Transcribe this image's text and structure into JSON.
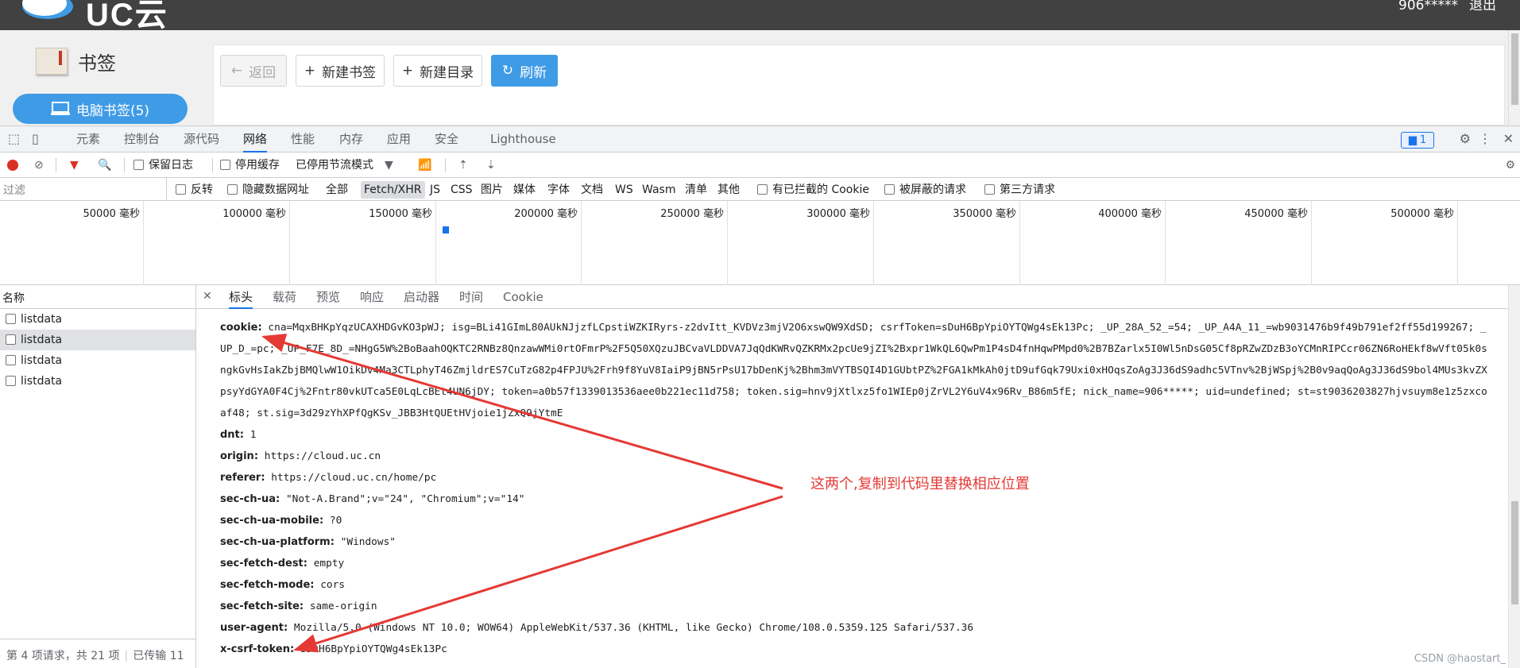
{
  "app": {
    "logo_text": "UC云",
    "user": "906*****",
    "logout": "退出",
    "sidebar_title": "书签",
    "pc_bookmarks": "电脑书签(5)",
    "toolbar": {
      "back": "返回",
      "new_bookmark": "新建书签",
      "new_folder": "新建目录",
      "refresh": "刷新"
    }
  },
  "devtools": {
    "tabs": [
      "元素",
      "控制台",
      "源代码",
      "网络",
      "性能",
      "内存",
      "应用",
      "安全",
      "Lighthouse"
    ],
    "active_tab": "网络",
    "issue_count": "1",
    "toolbar": {
      "preserve_log": "保留日志",
      "disable_cache": "停用缓存",
      "throttling": "已停用节流模式"
    },
    "filter": {
      "placeholder": "过滤",
      "invert": "反转",
      "hide_data_urls": "隐藏数据网址",
      "types": [
        "全部",
        "Fetch/XHR",
        "JS",
        "CSS",
        "图片",
        "媒体",
        "字体",
        "文档",
        "WS",
        "Wasm",
        "清单",
        "其他"
      ],
      "active_type": "Fetch/XHR",
      "blocked_cookies": "有已拦截的 Cookie",
      "blocked_requests": "被屏蔽的请求",
      "third_party": "第三方请求"
    },
    "timeline": [
      "50000 毫秒",
      "100000 毫秒",
      "150000 毫秒",
      "200000 毫秒",
      "250000 毫秒",
      "300000 毫秒",
      "350000 毫秒",
      "400000 毫秒",
      "450000 毫秒",
      "500000 毫秒"
    ],
    "list": {
      "header": "名称",
      "rows": [
        "listdata",
        "listdata",
        "listdata",
        "listdata"
      ],
      "selected_index": 1,
      "footer_requests": "第 4 项请求，共 21 项",
      "footer_transferred": "已传输 11"
    },
    "detail": {
      "tabs": [
        "标头",
        "载荷",
        "预览",
        "响应",
        "启动器",
        "时间",
        "Cookie"
      ],
      "active_tab": "标头",
      "headers": [
        {
          "key": "cookie:",
          "value": "cna=MqxBHKpYqzUCAXHDGvKO3pWJ; isg=BLi41GImL80AUkNJjzfLCpstiWZKIRyrs-z2dvItt_KVDVz3mjV2O6xswQW9XdSD; csrfToken=sDuH6BpYpiOYTQWg4sEk13Pc; _UP_28A_52_=54; _UP_A4A_11_=wb9031476b9f49b791ef2ff55d199267; _UP_D_=pc; _UP_F7E_8D_=NHgG5W%2BoBaahOQKTC2RNBz8QnzawWMi0rtOFmrP%2F5Q50XQzuJBCvaVLDDVA7JqQdKWRvQZKRMx2pcUe9jZI%2Bxpr1WkQL6QwPm1P4sD4fnHqwPMpd0%2B7BZarlx5I0Wl5nDsG05Cf8pRZwZDzB3oYCMnRIPCcr06ZN6RoHEkf8wVft05k0sngkGvHsIakZbjBMQlwW1OikDv4Ma3CTLphyT46ZmjldrES7CuTzG82p4FPJU%2Frh9f8YuV8IaiP9jBN5rPsU17bDenKj%2Bhm3mVYTBSQI4D1GUbtPZ%2FGA1kMkAh0jtD9ufGqk79Uxi0xHOqsZoAg3J36dS9adhc5VTnv%2BjWSpj%2B0v9aqQoAg3J36dS9bol4MUs3kvZXpsyYdGYA0F4Cj%2Fntr80vkUTca5E0LqLcBEt4UN6jDY; token=a0b57f1339013536aee0b221ec11d758; token.sig=hnv9jXtlxz5fo1WIEp0jZrVL2Y6uV4x96Rv_B86m5fE; nick_name=906*****; uid=undefined; st=st9036203827hjvsuym8e1z5zxcoaf48; st.sig=3d29zYhXPfQgKSv_JBB3HtQUEtHVjoie1jZxQ9jYtmE"
        },
        {
          "key": "dnt:",
          "value": "1"
        },
        {
          "key": "origin:",
          "value": "https://cloud.uc.cn"
        },
        {
          "key": "referer:",
          "value": "https://cloud.uc.cn/home/pc"
        },
        {
          "key": "sec-ch-ua:",
          "value": "\"Not-A.Brand\";v=\"24\", \"Chromium\";v=\"14\""
        },
        {
          "key": "sec-ch-ua-mobile:",
          "value": "?0"
        },
        {
          "key": "sec-ch-ua-platform:",
          "value": "\"Windows\""
        },
        {
          "key": "sec-fetch-dest:",
          "value": "empty"
        },
        {
          "key": "sec-fetch-mode:",
          "value": "cors"
        },
        {
          "key": "sec-fetch-site:",
          "value": "same-origin"
        },
        {
          "key": "user-agent:",
          "value": "Mozilla/5.0 (Windows NT 10.0; WOW64) AppleWebKit/537.36 (KHTML, like Gecko) Chrome/108.0.5359.125 Safari/537.36"
        },
        {
          "key": "x-csrf-token:",
          "value": "sDuH6BpYpiOYTQWg4sEk13Pc"
        }
      ]
    }
  },
  "annotation": {
    "text": "这两个,复制到代码里替换相应位置",
    "color": "#e53935"
  },
  "watermark": "CSDN @haostart_",
  "colors": {
    "accent": "#1a73e8",
    "app_blue": "#3f9be6",
    "record_red": "#d93025",
    "topbar": "#414141"
  }
}
